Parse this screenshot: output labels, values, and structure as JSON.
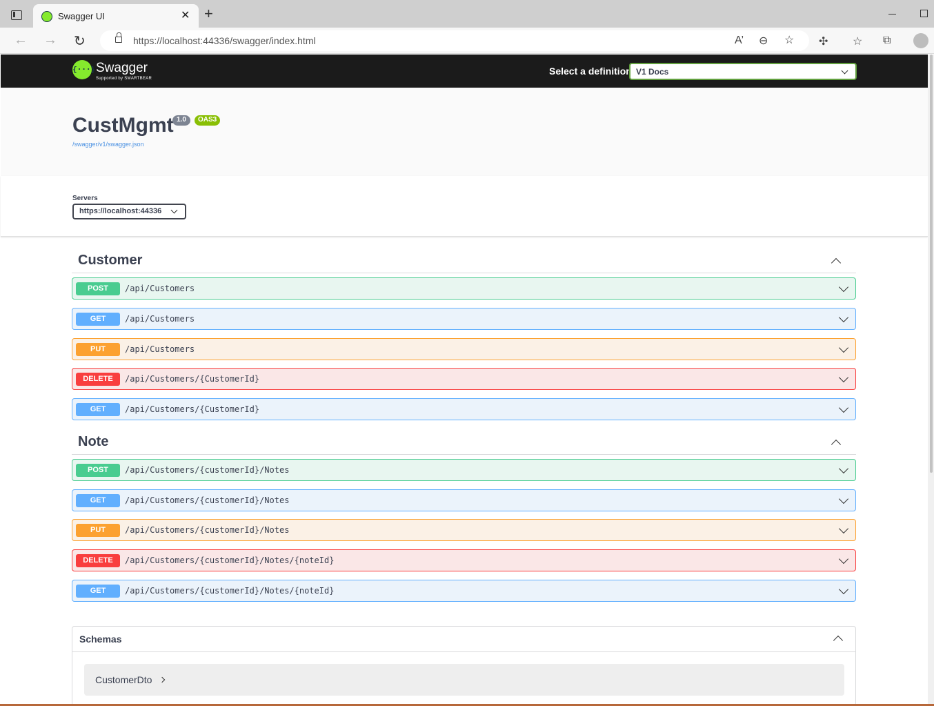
{
  "browser": {
    "tab_title": "Swagger UI",
    "tab_close": "✕",
    "new_tab": "+",
    "url": "https://localhost:44336/swagger/index.html",
    "back": "←",
    "forward": "→",
    "reload": "↻",
    "read_aloud": "A’",
    "zoom": "⊖",
    "favorite_add": "☆",
    "extensions": "✣",
    "favorites": "☆",
    "collections": "⧉"
  },
  "topbar": {
    "logo_mark": "{···}",
    "logo_text": "Swagger",
    "logo_sub": "Supported by SMARTBEAR",
    "definition_label": "Select a definition",
    "definition_selected": "V1 Docs"
  },
  "info": {
    "title": "CustMgmt",
    "version": "1.0",
    "oas": "OAS3",
    "spec_link": "/swagger/v1/swagger.json"
  },
  "servers": {
    "label": "Servers",
    "selected": "https://localhost:44336"
  },
  "tags": [
    {
      "name": "Customer",
      "operations": [
        {
          "method": "POST",
          "path": "/api/Customers"
        },
        {
          "method": "GET",
          "path": "/api/Customers"
        },
        {
          "method": "PUT",
          "path": "/api/Customers"
        },
        {
          "method": "DELETE",
          "path": "/api/Customers/{CustomerId}"
        },
        {
          "method": "GET",
          "path": "/api/Customers/{CustomerId}"
        }
      ]
    },
    {
      "name": "Note",
      "operations": [
        {
          "method": "POST",
          "path": "/api/Customers/{customerId}/Notes"
        },
        {
          "method": "GET",
          "path": "/api/Customers/{customerId}/Notes"
        },
        {
          "method": "PUT",
          "path": "/api/Customers/{customerId}/Notes"
        },
        {
          "method": "DELETE",
          "path": "/api/Customers/{customerId}/Notes/{noteId}"
        },
        {
          "method": "GET",
          "path": "/api/Customers/{customerId}/Notes/{noteId}"
        }
      ]
    }
  ],
  "schemas": {
    "title": "Schemas",
    "models": [
      "CustomerDto"
    ]
  },
  "colors": {
    "post": "#49cc90",
    "get": "#61affe",
    "put": "#fca130",
    "delete": "#f93e3e",
    "topbar": "#1b1b1b",
    "swagger_green": "#85ea2d"
  }
}
